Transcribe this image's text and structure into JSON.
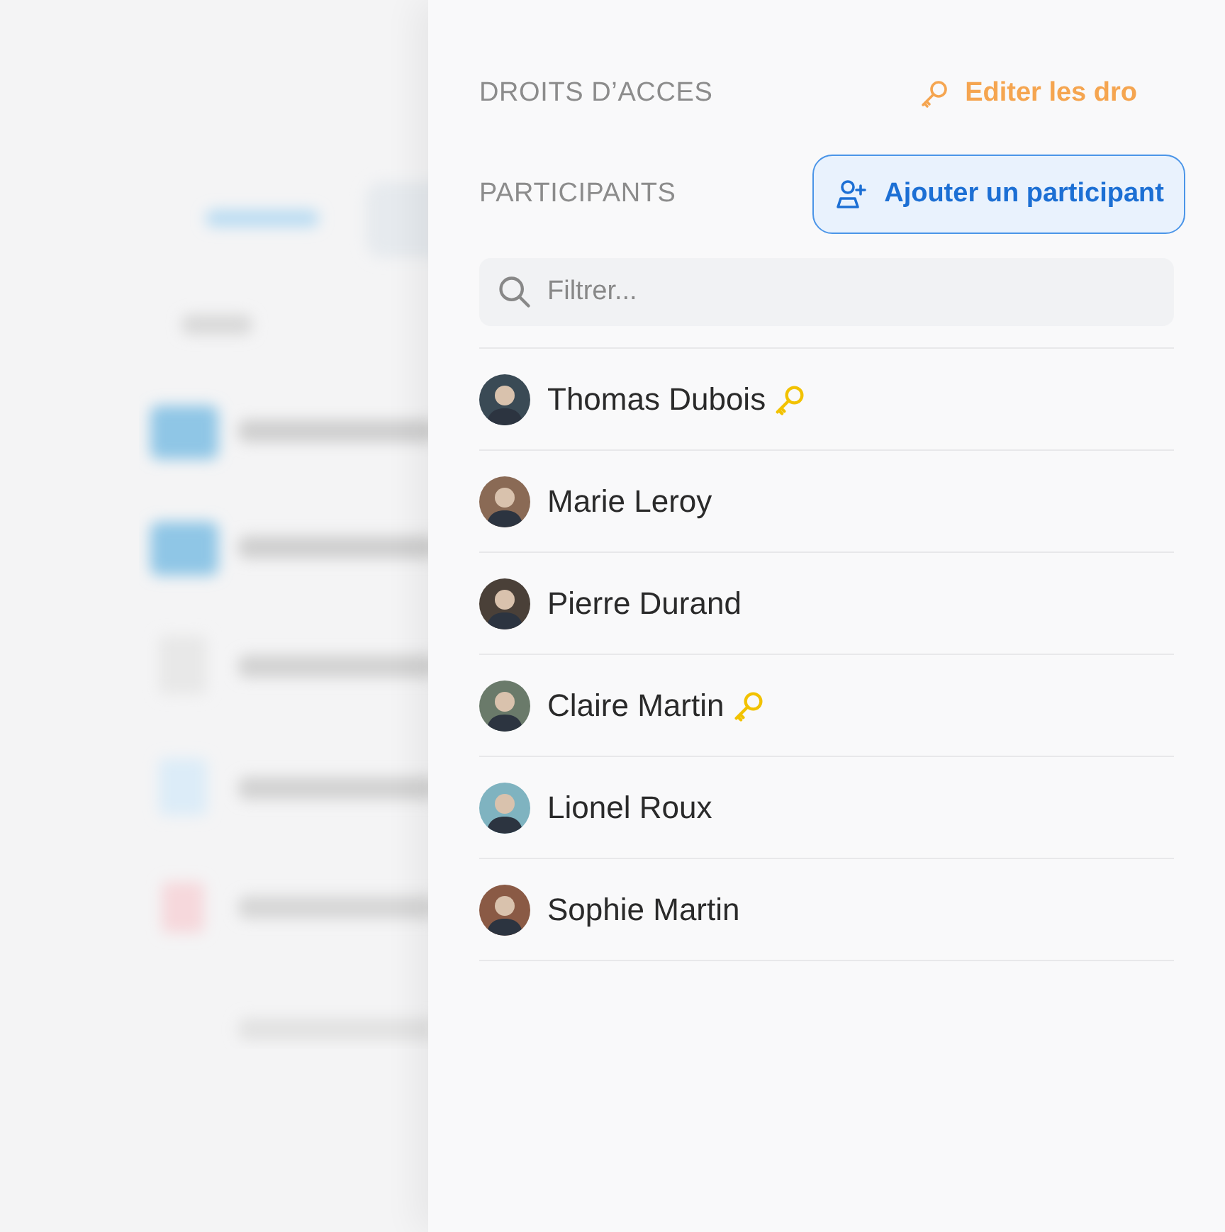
{
  "access_rights": {
    "title": "DROITS D’ACCES",
    "edit_link": "Editer les dro"
  },
  "participants": {
    "title": "PARTICIPANTS",
    "add_button": "Ajouter un participant",
    "filter": {
      "placeholder": "Filtrer..."
    },
    "items": [
      {
        "name": "Thomas Dubois",
        "has_key": true
      },
      {
        "name": "Marie Leroy",
        "has_key": false
      },
      {
        "name": "Pierre Durand",
        "has_key": false
      },
      {
        "name": "Claire Martin",
        "has_key": true
      },
      {
        "name": "Lionel Roux",
        "has_key": false
      },
      {
        "name": "Sophie Martin",
        "has_key": false
      }
    ]
  }
}
